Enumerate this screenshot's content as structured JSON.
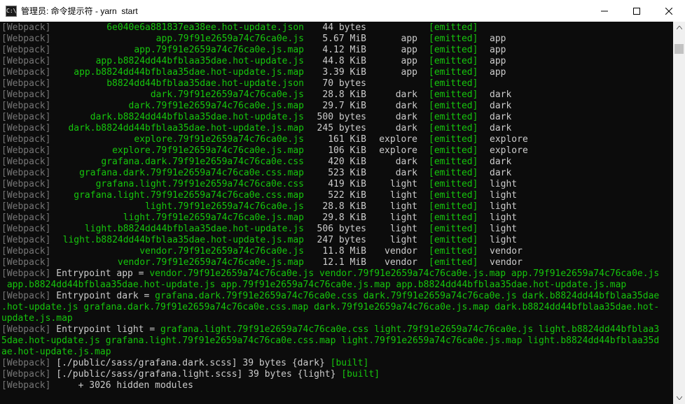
{
  "window": {
    "title": "管理员: 命令提示符 - yarn  start",
    "icon": "C:\\",
    "controls": {
      "minimize": "minimize-icon",
      "maximize": "maximize-icon",
      "close": "close-icon"
    }
  },
  "colors": {
    "green": "#16c60c",
    "gray": "#767676",
    "text": "#cccccc",
    "background": "#0c0c0c"
  },
  "webpack_tag": "[Webpack]",
  "assets": [
    {
      "file": "6e040e6a881837ea38ee.hot-update.json",
      "size": "44 bytes",
      "chunk": "",
      "status": "[emitted]",
      "names": ""
    },
    {
      "file": "app.79f91e2659a74c76ca0e.js",
      "size": "5.67 MiB",
      "chunk": "app",
      "status": "[emitted]",
      "names": "app"
    },
    {
      "file": "app.79f91e2659a74c76ca0e.js.map",
      "size": "4.12 MiB",
      "chunk": "app",
      "status": "[emitted]",
      "names": "app"
    },
    {
      "file": "app.b8824dd44bfblaa35dae.hot-update.js",
      "size": "44.8 KiB",
      "chunk": "app",
      "status": "[emitted]",
      "names": "app"
    },
    {
      "file": "app.b8824dd44bfblaa35dae.hot-update.js.map",
      "size": "3.39 KiB",
      "chunk": "app",
      "status": "[emitted]",
      "names": "app"
    },
    {
      "file": "b8824dd44bfblaa35dae.hot-update.json",
      "size": "70 bytes",
      "chunk": "",
      "status": "[emitted]",
      "names": ""
    },
    {
      "file": "dark.79f91e2659a74c76ca0e.js",
      "size": "28.8 KiB",
      "chunk": "dark",
      "status": "[emitted]",
      "names": "dark"
    },
    {
      "file": "dark.79f91e2659a74c76ca0e.js.map",
      "size": "29.7 KiB",
      "chunk": "dark",
      "status": "[emitted]",
      "names": "dark"
    },
    {
      "file": "dark.b8824dd44bfblaa35dae.hot-update.js",
      "size": "500 bytes",
      "chunk": "dark",
      "status": "[emitted]",
      "names": "dark"
    },
    {
      "file": "dark.b8824dd44bfblaa35dae.hot-update.js.map",
      "size": "245 bytes",
      "chunk": "dark",
      "status": "[emitted]",
      "names": "dark"
    },
    {
      "file": "explore.79f91e2659a74c76ca0e.js",
      "size": "161 KiB",
      "chunk": "explore",
      "status": "[emitted]",
      "names": "explore"
    },
    {
      "file": "explore.79f91e2659a74c76ca0e.js.map",
      "size": "106 KiB",
      "chunk": "explore",
      "status": "[emitted]",
      "names": "explore"
    },
    {
      "file": "grafana.dark.79f91e2659a74c76ca0e.css",
      "size": "420 KiB",
      "chunk": "dark",
      "status": "[emitted]",
      "names": "dark"
    },
    {
      "file": "grafana.dark.79f91e2659a74c76ca0e.css.map",
      "size": "523 KiB",
      "chunk": "dark",
      "status": "[emitted]",
      "names": "dark"
    },
    {
      "file": "grafana.light.79f91e2659a74c76ca0e.css",
      "size": "419 KiB",
      "chunk": "light",
      "status": "[emitted]",
      "names": "light"
    },
    {
      "file": "grafana.light.79f91e2659a74c76ca0e.css.map",
      "size": "522 KiB",
      "chunk": "light",
      "status": "[emitted]",
      "names": "light"
    },
    {
      "file": "light.79f91e2659a74c76ca0e.js",
      "size": "28.8 KiB",
      "chunk": "light",
      "status": "[emitted]",
      "names": "light"
    },
    {
      "file": "light.79f91e2659a74c76ca0e.js.map",
      "size": "29.8 KiB",
      "chunk": "light",
      "status": "[emitted]",
      "names": "light"
    },
    {
      "file": "light.b8824dd44bfblaa35dae.hot-update.js",
      "size": "506 bytes",
      "chunk": "light",
      "status": "[emitted]",
      "names": "light"
    },
    {
      "file": "light.b8824dd44bfblaa35dae.hot-update.js.map",
      "size": "247 bytes",
      "chunk": "light",
      "status": "[emitted]",
      "names": "light"
    },
    {
      "file": "vendor.79f91e2659a74c76ca0e.js",
      "size": "11.8 MiB",
      "chunk": "vendor",
      "status": "[emitted]",
      "names": "vendor"
    },
    {
      "file": "vendor.79f91e2659a74c76ca0e.js.map",
      "size": "12.1 MiB",
      "chunk": "vendor",
      "status": "[emitted]",
      "names": "vendor"
    }
  ],
  "entrypoints": [
    {
      "label": " Entrypoint app = ",
      "lines": [
        "vendor.79f91e2659a74c76ca0e.js vendor.79f91e2659a74c76ca0e.js.map app.79f91e2659a74c76ca0e.js",
        " app.b8824dd44bfblaa35dae.hot-update.js app.79f91e2659a74c76ca0e.js.map app.b8824dd44bfblaa35dae.hot-update.js.map"
      ]
    },
    {
      "label": " Entrypoint dark = ",
      "lines": [
        "grafana.dark.79f91e2659a74c76ca0e.css dark.79f91e2659a74c76ca0e.js dark.b8824dd44bfblaa35dae",
        ".hot-update.js grafana.dark.79f91e2659a74c76ca0e.css.map dark.79f91e2659a74c76ca0e.js.map dark.b8824dd44bfblaa35dae.hot-",
        "update.js.map"
      ]
    },
    {
      "label": " Entrypoint light = ",
      "lines": [
        "grafana.light.79f91e2659a74c76ca0e.css light.79f91e2659a74c76ca0e.js light.b8824dd44bfblaa3",
        "5dae.hot-update.js grafana.light.79f91e2659a74c76ca0e.css.map light.79f91e2659a74c76ca0e.js.map light.b8824dd44bfblaa35d",
        "ae.hot-update.js.map"
      ]
    }
  ],
  "built": [
    {
      "path": " [./public/sass/grafana.dark.scss] 39 bytes ",
      "chunk": "{dark}",
      "status": " [built]"
    },
    {
      "path": " [./public/sass/grafana.light.scss] 39 bytes ",
      "chunk": "{light}",
      "status": " [built]"
    }
  ],
  "hidden_modules": "     + 3026 hidden modules"
}
